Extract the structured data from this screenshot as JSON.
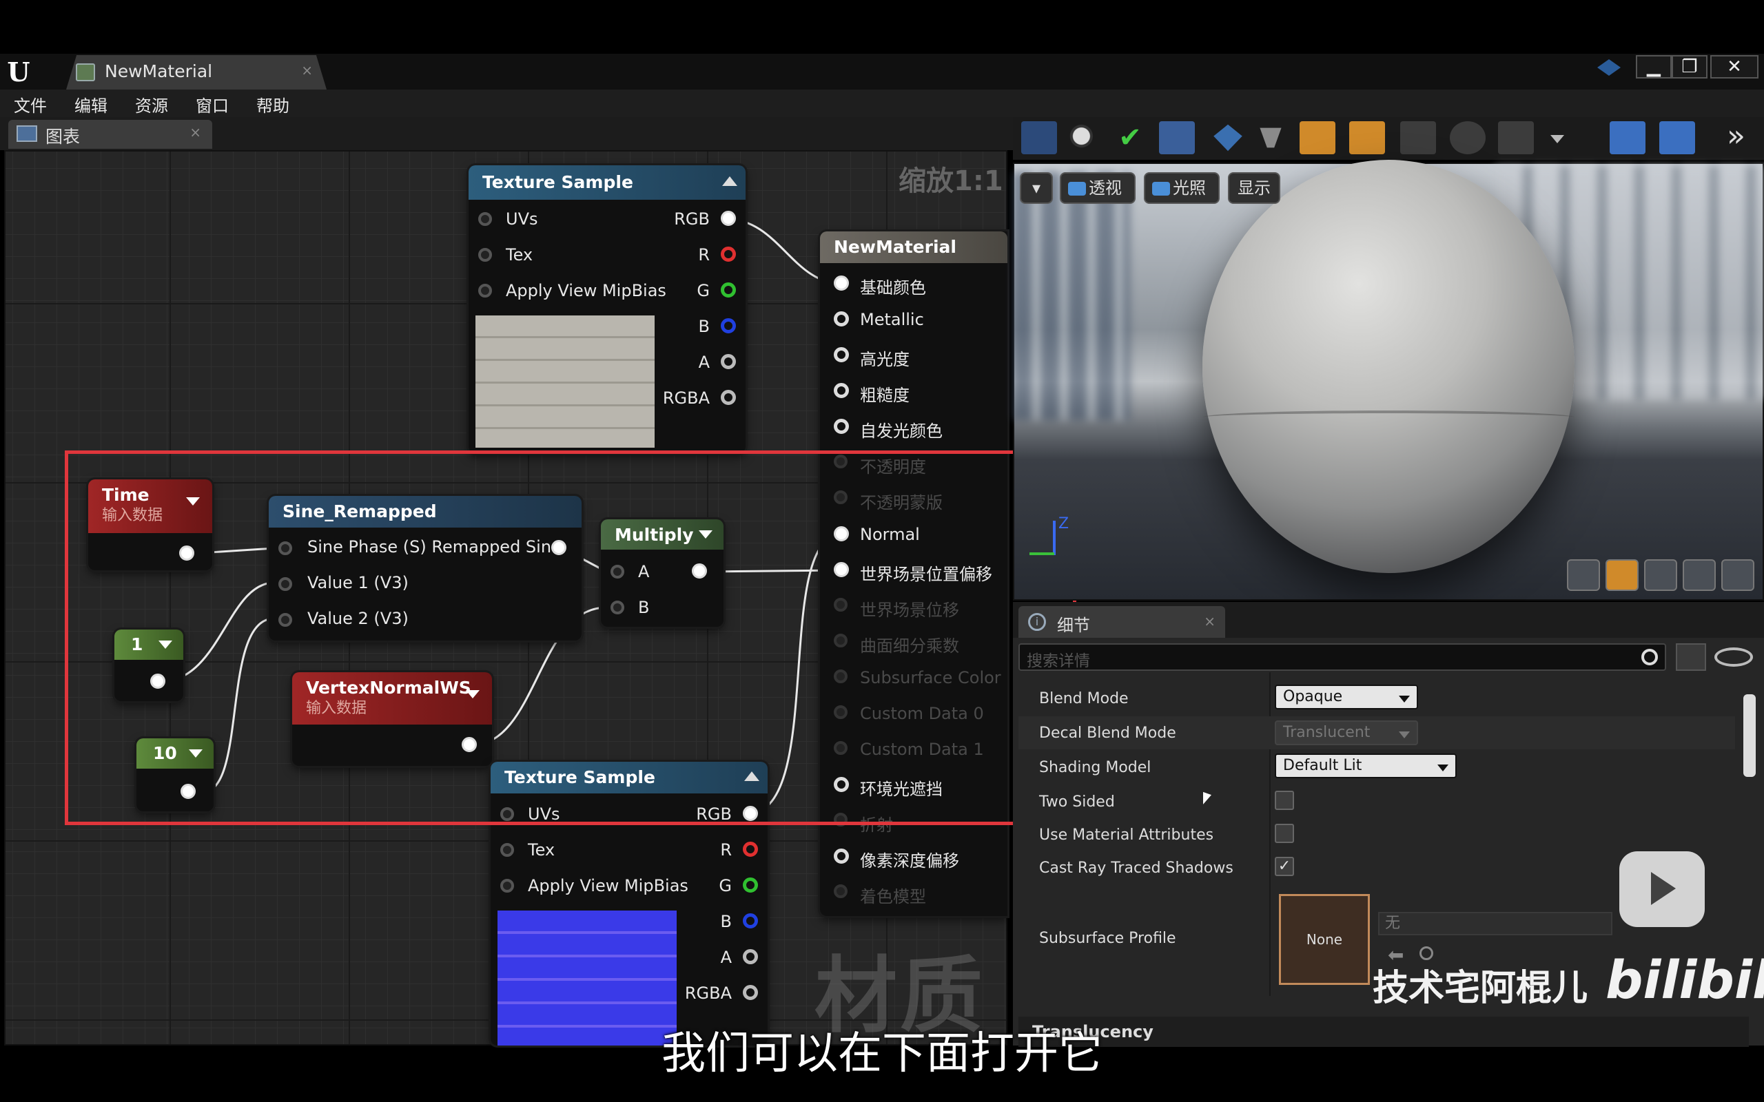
{
  "window": {
    "tab_title": "NewMaterial",
    "tab_close": "×",
    "logo": "U",
    "win_buttons": [
      "▁",
      "❐",
      "✕"
    ]
  },
  "menu": [
    "文件",
    "编辑",
    "资源",
    "窗口",
    "帮助"
  ],
  "graph": {
    "tab_label": "图表",
    "tab_close": "×",
    "zoom_label": "缩放1:1",
    "watermark": "材质"
  },
  "nodes": {
    "tex1": {
      "title": "Texture Sample",
      "inputs": [
        "UVs",
        "Tex",
        "Apply View MipBias"
      ],
      "outputs": [
        "RGB",
        "R",
        "G",
        "B",
        "A",
        "RGBA"
      ]
    },
    "tex2": {
      "title": "Texture Sample",
      "inputs": [
        "UVs",
        "Tex",
        "Apply View MipBias"
      ],
      "outputs": [
        "RGB",
        "R",
        "G",
        "B",
        "A",
        "RGBA"
      ]
    },
    "material": {
      "title": "NewMaterial",
      "pins": [
        "基础颜色",
        "Metallic",
        "高光度",
        "粗糙度",
        "自发光颜色",
        "不透明度",
        "不透明蒙版",
        "Normal",
        "世界场景位置偏移",
        "世界场景位移",
        "曲面细分乘数",
        "Subsurface Color",
        "Custom Data 0",
        "Custom Data 1",
        "环境光遮挡",
        "折射",
        "像素深度偏移",
        "着色模型"
      ]
    },
    "time": {
      "title": "Time",
      "subtitle": "输入数据"
    },
    "sine": {
      "title": "Sine_Remapped",
      "inputs": [
        "Sine Phase (S) Remapped Sine",
        "Value 1 (V3)",
        "Value 2 (V3)"
      ]
    },
    "multiply": {
      "title": "Multiply",
      "inputs": [
        "A",
        "B"
      ]
    },
    "const1": {
      "value": "1"
    },
    "const10": {
      "value": "10"
    },
    "vnws": {
      "title": "VertexNormalWS",
      "subtitle": "输入数据"
    }
  },
  "viewport": {
    "btn_perspective": "透视",
    "btn_lit": "光照",
    "btn_show": "显示",
    "axis_label": "Z"
  },
  "details": {
    "tab_label": "细节",
    "tab_close": "×",
    "search_placeholder": "搜索详情",
    "props": [
      {
        "label": "Blend Mode",
        "value": "Opaque"
      },
      {
        "label": "Decal Blend Mode",
        "value": "Translucent"
      },
      {
        "label": "Shading Model",
        "value": "Default Lit"
      },
      {
        "label": "Two Sided",
        "checked": false
      },
      {
        "label": "Use Material Attributes",
        "checked": false
      },
      {
        "label": "Cast Ray Traced Shadows",
        "checked": true
      },
      {
        "label": "Subsurface Profile",
        "thumb": "None",
        "asset": "无"
      }
    ],
    "section": "Translucency"
  },
  "overlay": {
    "subtitle": "我们可以在下面打开它",
    "uploader": "技术宅阿棍儿",
    "brand": "bilibili"
  }
}
